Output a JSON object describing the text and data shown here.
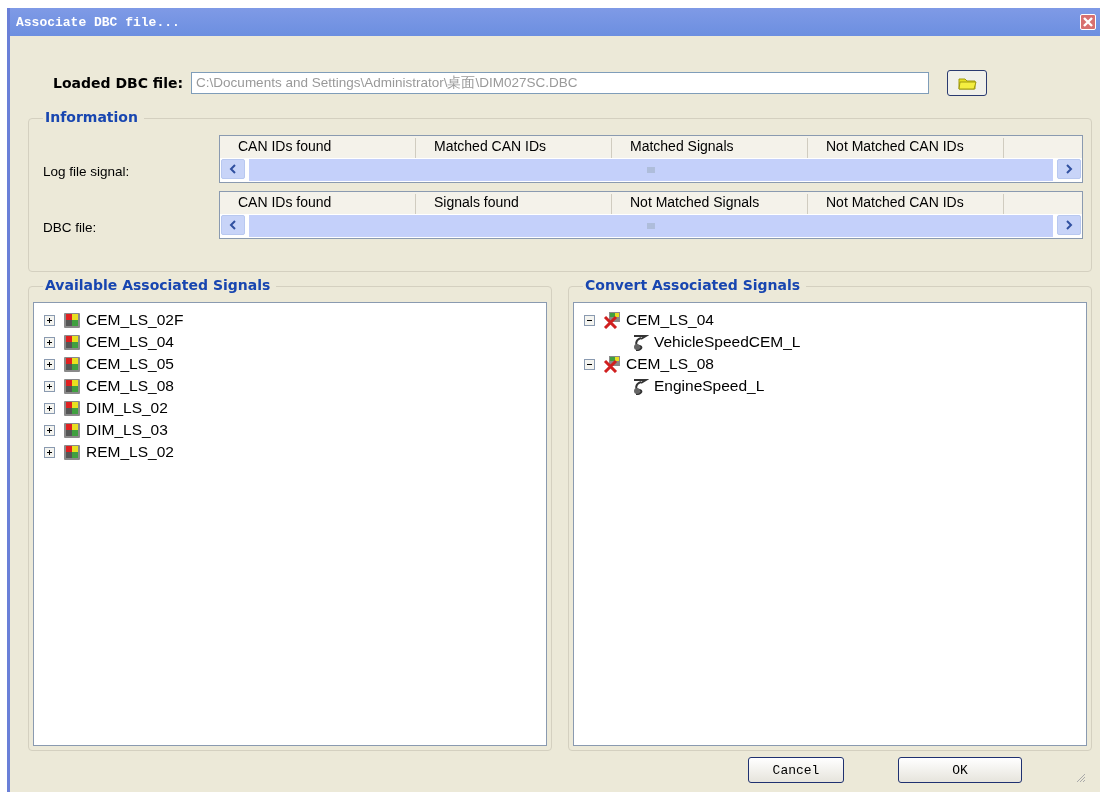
{
  "window": {
    "title": "Associate DBC file..."
  },
  "loaded_file": {
    "label": "Loaded DBC file:",
    "value": "C:\\Documents and Settings\\Administrator\\桌面\\DIM027SC.DBC"
  },
  "information": {
    "title": "Information",
    "lists": [
      {
        "label": "Log file signal:",
        "columns": [
          "CAN IDs found",
          "Matched CAN IDs",
          "Matched Signals",
          "Not Matched CAN IDs"
        ]
      },
      {
        "label": "DBC file:",
        "columns": [
          "CAN IDs found",
          "Signals found",
          "Not Matched Signals",
          "Not Matched CAN IDs"
        ]
      }
    ]
  },
  "available": {
    "title": "Available Associated Signals",
    "items": [
      {
        "label": "CEM_LS_02F",
        "kind": "message",
        "expanded": false
      },
      {
        "label": "CEM_LS_04",
        "kind": "message",
        "expanded": false
      },
      {
        "label": "CEM_LS_05",
        "kind": "message",
        "expanded": false
      },
      {
        "label": "CEM_LS_08",
        "kind": "message",
        "expanded": false
      },
      {
        "label": "DIM_LS_02",
        "kind": "message",
        "expanded": false
      },
      {
        "label": "DIM_LS_03",
        "kind": "message",
        "expanded": false
      },
      {
        "label": "REM_LS_02",
        "kind": "message",
        "expanded": false
      }
    ]
  },
  "convert": {
    "title": "Convert Associated Signals",
    "items": [
      {
        "label": "CEM_LS_04",
        "kind": "converted",
        "expanded": true,
        "children": [
          {
            "label": "VehicleSpeedCEM_L",
            "kind": "signal"
          }
        ]
      },
      {
        "label": "CEM_LS_08",
        "kind": "converted",
        "expanded": true,
        "children": [
          {
            "label": "EngineSpeed_L",
            "kind": "signal"
          }
        ]
      }
    ]
  },
  "buttons": [
    "Cancel",
    "OK"
  ]
}
